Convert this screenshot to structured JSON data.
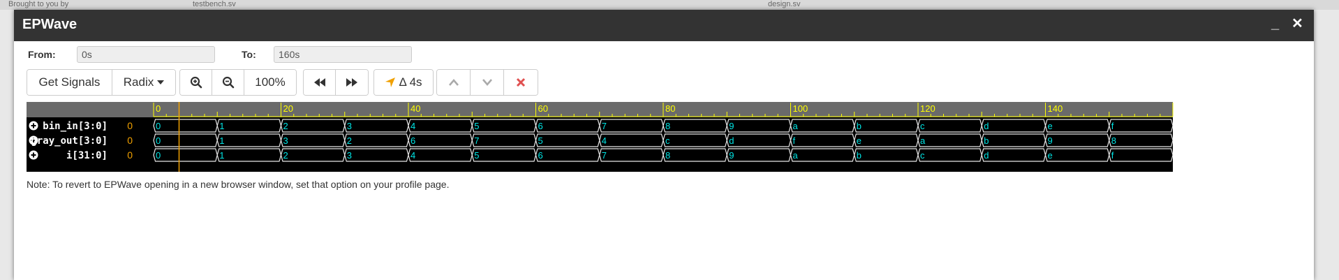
{
  "background": {
    "top_left_text": "Brought to you by",
    "tab1": "testbench.sv",
    "tab2": "design.sv"
  },
  "window": {
    "title": "EPWave",
    "minimize_icon": "minimize-icon",
    "close_icon": "close-icon"
  },
  "range": {
    "from_label": "From:",
    "from_value": "0s",
    "to_label": "To:",
    "to_value": "160s"
  },
  "toolbar": {
    "get_signals": "Get Signals",
    "radix": "Radix",
    "zoom_level": "100%",
    "delta": "Δ 4s"
  },
  "waveform": {
    "time_ticks": [
      "0",
      "20",
      "40",
      "60",
      "80",
      "100",
      "120",
      "140"
    ],
    "time_range": [
      0,
      160
    ],
    "cursor_time": 4,
    "signals": [
      {
        "name": "bin_in[3:0]",
        "cursor_value": "0",
        "values": [
          "0",
          "1",
          "2",
          "3",
          "4",
          "5",
          "6",
          "7",
          "8",
          "9",
          "a",
          "b",
          "c",
          "d",
          "e",
          "f"
        ]
      },
      {
        "name": "gray_out[3:0]",
        "cursor_value": "0",
        "values": [
          "0",
          "1",
          "3",
          "2",
          "6",
          "7",
          "5",
          "4",
          "c",
          "d",
          "f",
          "e",
          "a",
          "b",
          "9",
          "8"
        ]
      },
      {
        "name": "i[31:0]",
        "cursor_value": "0",
        "values": [
          "0",
          "1",
          "2",
          "3",
          "4",
          "5",
          "6",
          "7",
          "8",
          "9",
          "a",
          "b",
          "c",
          "d",
          "e",
          "f"
        ]
      }
    ]
  },
  "note": "Note: To revert to EPWave opening in a new browser window, set that option on your profile page.",
  "colors": {
    "title_bar": "#333333",
    "wave_bg": "#000000",
    "ruler_bg": "#6a6a6a",
    "ruler_text": "#ffff00",
    "value_text": "#00e5e5",
    "cursor": "#f0a000",
    "close_red": "#e05050"
  }
}
